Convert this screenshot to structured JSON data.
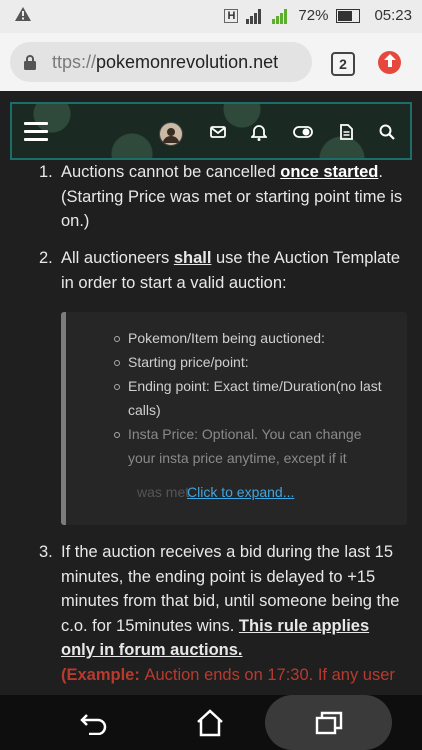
{
  "status_bar": {
    "alert_icon": "warning-triangle-icon",
    "network_badge": "H",
    "sim_badge": "1",
    "battery_percent": "72%",
    "time": "05:23"
  },
  "browser": {
    "url_prefix": "ttps://",
    "url_domain": "pokemonrevolution.net",
    "tab_count": "2",
    "update_icon": "arrow-up-icon"
  },
  "forum_header": {
    "icons": [
      "menu-icon",
      "avatar",
      "mail-icon",
      "bell-icon",
      "toggle-icon",
      "document-icon",
      "search-icon"
    ]
  },
  "content": {
    "item1_num": "1.",
    "item1_part_a": "Auctions cannot be cancelled ",
    "item1_link": "once started",
    "item1_part_b": ". (Starting Price was met or starting point time is on.)",
    "item2_num": "2.",
    "item2_part_a": "All auctioneers ",
    "item2_bold": "shall",
    "item2_part_b": " use the Auction Template in order to start a valid auction:",
    "quote_items": [
      "Pokemon/Item being auctioned:",
      "Starting price/point:",
      "Ending point: Exact time/Duration(no last calls)",
      "Insta Price: Optional. You can change your insta price anytime, except if it",
      "was met"
    ],
    "expand_link": "Click to expand...",
    "item3_num": "3.",
    "item3_text": "If the auction receives a bid during the last 15 minutes, the ending point is delayed to +15 minutes from that bid, until someone being the c.o. for 15minutes wins. ",
    "item3_bold": "This rule applies only in forum auctions.",
    "item3_cut_a": "(Example: ",
    "item3_cut_b": "Auction ends on 17:30. If any user"
  },
  "nav": {
    "back": "back-icon",
    "home": "home-icon",
    "recents": "recents-icon"
  }
}
